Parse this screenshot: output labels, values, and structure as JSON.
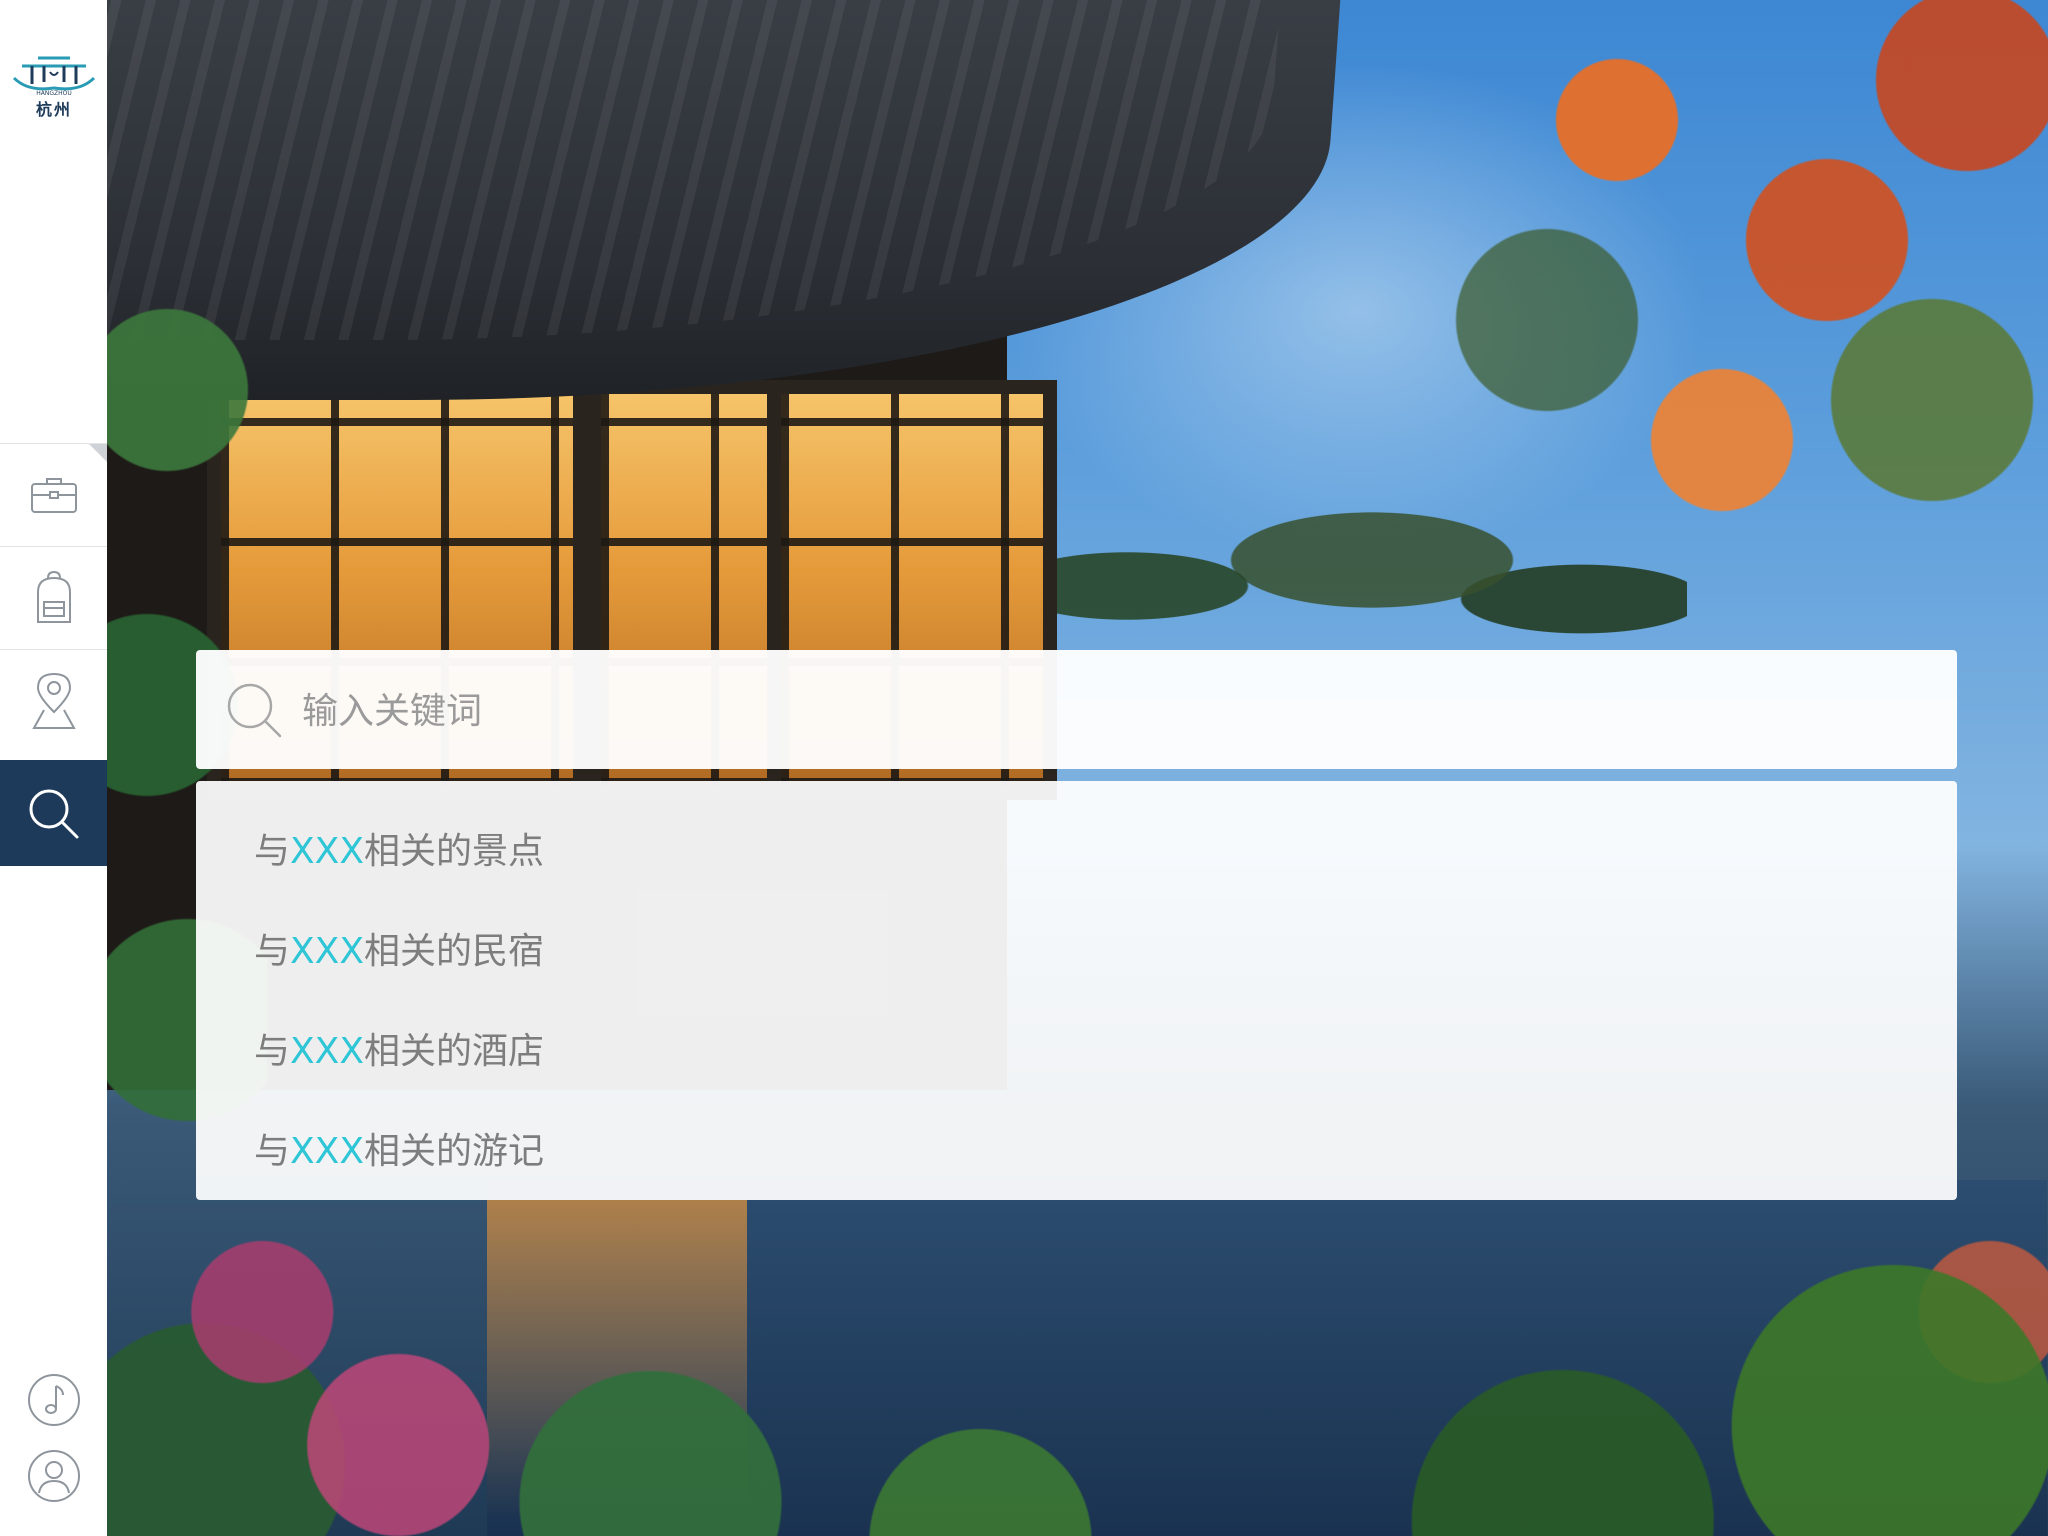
{
  "app": {
    "logo_text": "杭州"
  },
  "sidebar": {
    "items": [
      {
        "name": "briefcase",
        "icon": "briefcase-icon",
        "active": false
      },
      {
        "name": "backpack",
        "icon": "backpack-icon",
        "active": false
      },
      {
        "name": "location",
        "icon": "map-pin-icon",
        "active": false
      },
      {
        "name": "search",
        "icon": "search-icon",
        "active": true
      }
    ],
    "bottom": [
      {
        "name": "music",
        "icon": "music-note-icon"
      },
      {
        "name": "profile",
        "icon": "user-icon"
      }
    ],
    "active_color": "#1e3a5a"
  },
  "search": {
    "placeholder": "输入关键词",
    "value": ""
  },
  "suggestions": {
    "keyword_color": "#2ec6d6",
    "items": [
      {
        "prefix": "与",
        "keyword": "XXX",
        "suffix": "相关的景点"
      },
      {
        "prefix": "与",
        "keyword": "XXX",
        "suffix": "相关的民宿"
      },
      {
        "prefix": "与",
        "keyword": "XXX",
        "suffix": "相关的酒店"
      },
      {
        "prefix": "与",
        "keyword": "XXX",
        "suffix": "相关的游记"
      }
    ]
  }
}
